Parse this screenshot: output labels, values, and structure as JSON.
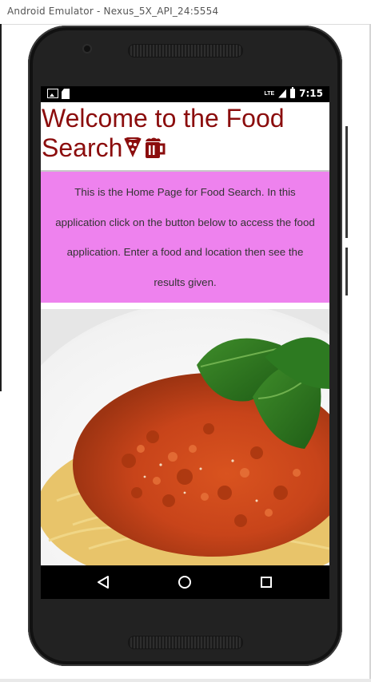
{
  "window": {
    "title": "Android Emulator - Nexus_5X_API_24:5554"
  },
  "statusbar": {
    "network": "LTE",
    "time": "7:15"
  },
  "app": {
    "welcome_line1": "Welcome to the Food",
    "welcome_line2": "Search",
    "intro_text": "This is the Home Page for Food Search. In this application click on the button below to access the food application. Enter a food and location then see the results given.",
    "title_color": "#8b0d0d",
    "info_background": "#ee82ee",
    "image_icon": "spaghetti-bolognese-photo"
  },
  "navbar": {
    "icons": [
      "back-icon",
      "home-icon",
      "recents-icon"
    ]
  }
}
